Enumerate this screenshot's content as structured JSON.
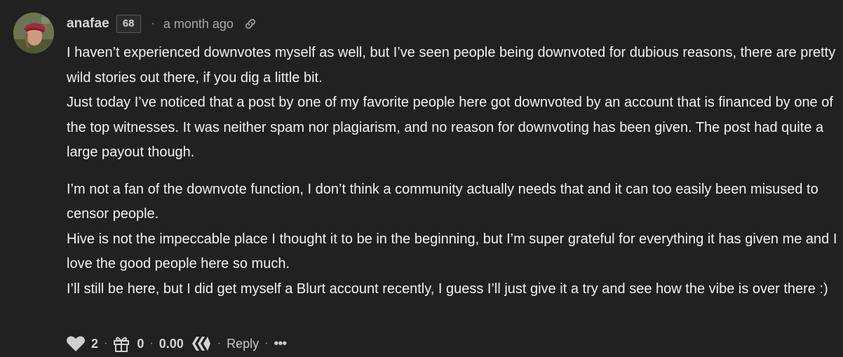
{
  "comment": {
    "author": "anafae",
    "reputation": "68",
    "separator": "·",
    "timestamp": "a month ago",
    "paragraphs_block1": [
      "I haven’t experienced downvotes myself as well, but I’ve seen people being downvoted for dubious reasons, there are pretty wild stories out there, if you dig a little bit.",
      "Just today I’ve noticed that a post by one of my favorite people here got downvoted by an account that is financed by one of the top witnesses. It was neither spam nor plagiarism, and no reason for downvoting has been given. The post had quite a large payout though."
    ],
    "paragraphs_block2": [
      "I’m not a fan of the downvote function, I don’t think a community actually needs that and it can too easily been misused to censor people.",
      "Hive is not the impeccable place I thought it to be in the beginning, but I’m super grateful for everything it has given me and I love the good people here so much.",
      "I’ll still be here, but I did get myself a Blurt account recently, I guess I’ll just give it a try and see how the vibe is over there :)"
    ],
    "footer": {
      "votes": "2",
      "gifts": "0",
      "payout": "0.00",
      "reply_label": "Reply",
      "more_label": "•••",
      "separator": "·"
    }
  },
  "icons": {
    "avatar": "avatar-image",
    "link": "link-icon",
    "heart": "heart-icon",
    "gift": "gift-icon",
    "hive": "hive-logo-icon"
  },
  "colors": {
    "background": "#212121",
    "text": "#f2f2f2",
    "muted": "#a8a8a8"
  }
}
